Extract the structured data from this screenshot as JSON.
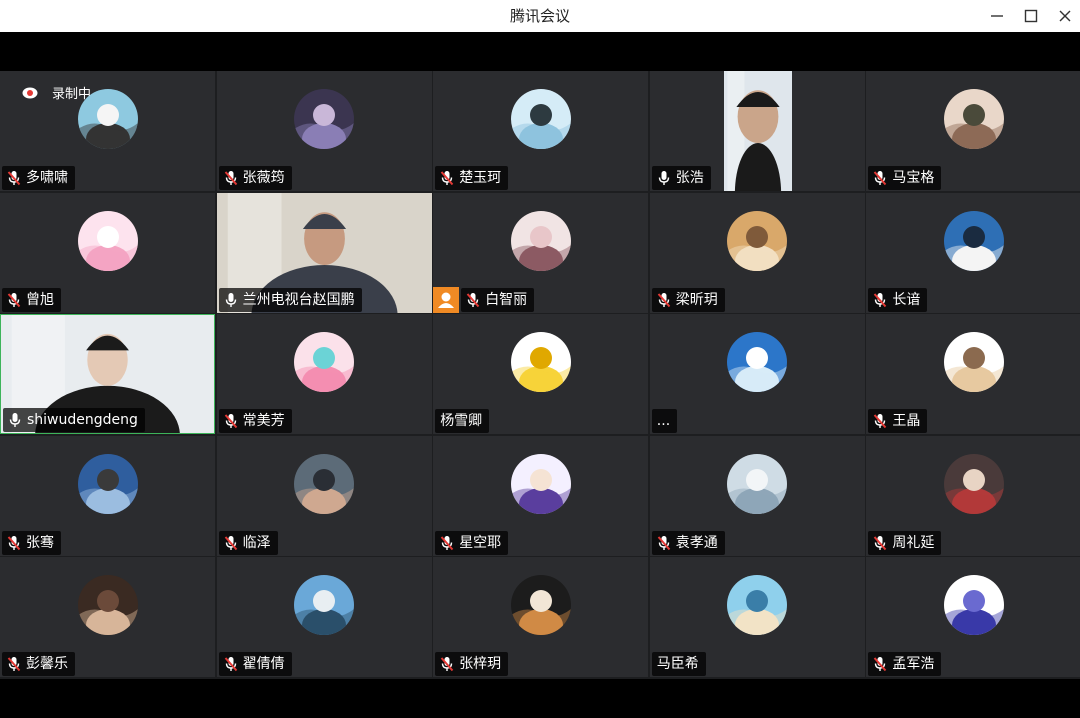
{
  "window": {
    "title": "腾讯会议",
    "minimize": "—",
    "maximize": "☐",
    "close": "✕"
  },
  "recording": {
    "label": "录制中"
  },
  "participants": [
    {
      "name": "多啸啸",
      "mic": "muted",
      "kind": "avatar",
      "colors": [
        "#8ec9e0",
        "#333333",
        "#f5f5f5"
      ]
    },
    {
      "name": "张薇筠",
      "mic": "muted",
      "kind": "avatar",
      "colors": [
        "#3b3550",
        "#8a7fb5",
        "#c9b7d8"
      ]
    },
    {
      "name": "楚玉珂",
      "mic": "muted",
      "kind": "avatar",
      "colors": [
        "#d5ecf7",
        "#8fc3de",
        "#2d3a40"
      ]
    },
    {
      "name": "张浩",
      "mic": "on",
      "kind": "video-narrow",
      "colors": [
        "#dfe6ec",
        "#1a1a1a",
        "#caa58a"
      ]
    },
    {
      "name": "马宝格",
      "mic": "muted",
      "kind": "avatar",
      "colors": [
        "#e9d7c9",
        "#8d6b57",
        "#4a4a3a"
      ]
    },
    {
      "name": "曾旭",
      "mic": "muted",
      "kind": "avatar",
      "colors": [
        "#fde3ee",
        "#f4a5c3",
        "#ffffff"
      ]
    },
    {
      "name": "兰州电视台赵国鹏",
      "mic": "on",
      "kind": "video",
      "colors": [
        "#d9d4ca",
        "#3a3f4a",
        "#c69a80"
      ]
    },
    {
      "name": "白智丽",
      "mic": "muted",
      "kind": "avatar",
      "host": true,
      "colors": [
        "#f1e4e4",
        "#8c5a63",
        "#e8c6c9"
      ]
    },
    {
      "name": "梁昕玥",
      "mic": "muted",
      "kind": "avatar",
      "colors": [
        "#d9a86a",
        "#f2dfc2",
        "#7f5a3a"
      ]
    },
    {
      "name": "长谙",
      "mic": "muted",
      "kind": "avatar",
      "colors": [
        "#2e6fb5",
        "#f4f4f4",
        "#1a2b40"
      ]
    },
    {
      "name": "shiwudengdeng",
      "mic": "on",
      "kind": "video-active",
      "colors": [
        "#e8ecef",
        "#1b1b1b",
        "#e4c9b5"
      ]
    },
    {
      "name": "常美芳",
      "mic": "muted",
      "kind": "avatar",
      "colors": [
        "#fbe1ea",
        "#f48fb1",
        "#6bd3d6"
      ]
    },
    {
      "name": "杨雪卿",
      "mic": "none",
      "kind": "avatar",
      "colors": [
        "#ffffff",
        "#f7d33a",
        "#e0a800"
      ]
    },
    {
      "name": "...",
      "mic": "none",
      "kind": "avatar",
      "colors": [
        "#2c76c9",
        "#d8ecf8",
        "#ffffff"
      ]
    },
    {
      "name": "王晶",
      "mic": "muted",
      "kind": "avatar",
      "colors": [
        "#ffffff",
        "#e7c9a0",
        "#8b6a4f"
      ]
    },
    {
      "name": "张骞",
      "mic": "muted",
      "kind": "avatar",
      "colors": [
        "#2f5e9e",
        "#9cbde0",
        "#3a3a3a"
      ]
    },
    {
      "name": "临泽",
      "mic": "muted",
      "kind": "avatar",
      "colors": [
        "#5c6b78",
        "#cfa890",
        "#2a2e35"
      ]
    },
    {
      "name": "星空耶",
      "mic": "muted",
      "kind": "avatar",
      "colors": [
        "#f4f0ff",
        "#5a3f9e",
        "#f5e3d4"
      ]
    },
    {
      "name": "袁孝通",
      "mic": "muted",
      "kind": "avatar",
      "colors": [
        "#cfdce5",
        "#8fa6b8",
        "#f2f5f7"
      ]
    },
    {
      "name": "周礼延",
      "mic": "muted",
      "kind": "avatar",
      "colors": [
        "#4a3a3a",
        "#b23a3a",
        "#e8d4c4"
      ]
    },
    {
      "name": "彭馨乐",
      "mic": "muted",
      "kind": "avatar",
      "colors": [
        "#3a2a22",
        "#d8b59a",
        "#6b4a3a"
      ]
    },
    {
      "name": "翟倩倩",
      "mic": "muted",
      "kind": "avatar",
      "colors": [
        "#6aa8d8",
        "#2b4f6b",
        "#e8eef2"
      ]
    },
    {
      "name": "张梓玥",
      "mic": "muted",
      "kind": "avatar",
      "colors": [
        "#1c1c1c",
        "#d08a45",
        "#f2e6d6"
      ]
    },
    {
      "name": "马臣希",
      "mic": "none",
      "kind": "avatar",
      "colors": [
        "#8fd0ec",
        "#f2e3c6",
        "#3a7ea8"
      ]
    },
    {
      "name": "孟军浩",
      "mic": "muted",
      "kind": "avatar",
      "colors": [
        "#ffffff",
        "#3a3aa8",
        "#6a6ad0"
      ]
    }
  ]
}
